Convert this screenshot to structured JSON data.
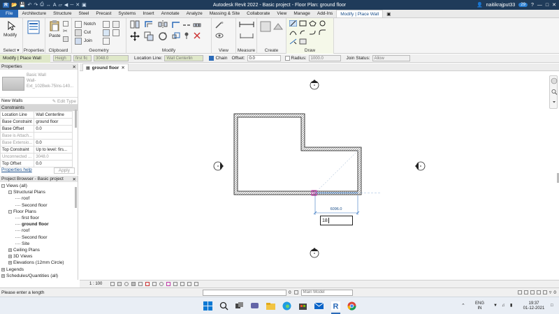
{
  "titlebar": {
    "title": "Autodesk Revit 2022 - Basic project - Floor Plan: ground floor",
    "user": "naitikrajput33",
    "timer": "29"
  },
  "tabs": [
    "File",
    "Architecture",
    "Structure",
    "Steel",
    "Precast",
    "Systems",
    "Insert",
    "Annotate",
    "Analyze",
    "Massing & Site",
    "Collaborate",
    "View",
    "Manage",
    "Add-Ins",
    "Modify | Place Wall"
  ],
  "active_tab": "Modify | Place Wall",
  "ribbon": {
    "select_label": "Select",
    "modify_label": "Modify",
    "properties_label": "Properties",
    "clipboard_label": "Clipboard",
    "paste_label": "Paste",
    "geometry_label": "Geometry",
    "notch_label": "Notch",
    "cut_label": "Cut",
    "join_label": "Join",
    "modify_panel_label": "Modify",
    "view_label": "View",
    "measure_label": "Measure",
    "create_label": "Create",
    "draw_label": "Draw"
  },
  "options_bar": {
    "context": "Modify | Place Wall",
    "height_label": "Heigh",
    "height_value": "first flc",
    "height_number": "3048.0",
    "location_line_label": "Location Line:",
    "location_line_value": "Wall Centerlin",
    "chain_label": "Chain",
    "offset_label": "Offset:",
    "offset_value": "0.0",
    "radius_label": "Radius:",
    "radius_value": "1000.0",
    "join_status_label": "Join Status:",
    "join_status_value": "Allow"
  },
  "properties": {
    "title": "Properties",
    "type_name_line1": "Basic Wall",
    "type_name_line2": "Wall-",
    "type_name_line3": "Ext_102Bwk-75Ins-140...",
    "new_walls": "New Walls",
    "edit_type": "Edit Type",
    "section": "Constraints",
    "rows": [
      {
        "k": "Location Line",
        "v": "Wall Centerline"
      },
      {
        "k": "Base Constraint",
        "v": "ground floor"
      },
      {
        "k": "Base Offset",
        "v": "0.0"
      },
      {
        "k": "Base is Attach...",
        "v": ""
      },
      {
        "k": "Base Extensio...",
        "v": "0.0"
      },
      {
        "k": "Top Constraint",
        "v": "Up to level: firs..."
      },
      {
        "k": "Unconnected ...",
        "v": "3048.0"
      },
      {
        "k": "Top Offset",
        "v": "0.0"
      }
    ],
    "help_link": "Properties help",
    "apply_label": "Apply"
  },
  "project_browser": {
    "title": "Project Browser - Basic project",
    "items": [
      {
        "label": "Views (all)",
        "level": 0,
        "toggle": "-"
      },
      {
        "label": "Structural Plans",
        "level": 1,
        "toggle": "-"
      },
      {
        "label": "roof",
        "level": 2,
        "toggle": ""
      },
      {
        "label": "Second floor",
        "level": 2,
        "toggle": ""
      },
      {
        "label": "Floor Plans",
        "level": 1,
        "toggle": "-"
      },
      {
        "label": "first floor",
        "level": 2,
        "toggle": ""
      },
      {
        "label": "ground floor",
        "level": 2,
        "toggle": "",
        "bold": true
      },
      {
        "label": "roof",
        "level": 2,
        "toggle": ""
      },
      {
        "label": "Second floor",
        "level": 2,
        "toggle": ""
      },
      {
        "label": "Site",
        "level": 2,
        "toggle": ""
      },
      {
        "label": "Ceiling Plans",
        "level": 1,
        "toggle": "+"
      },
      {
        "label": "3D Views",
        "level": 1,
        "toggle": "+"
      },
      {
        "label": "Elevations (12mm Circle)",
        "level": 1,
        "toggle": "+"
      },
      {
        "label": "Legends",
        "level": 0,
        "toggle": "+"
      },
      {
        "label": "Schedules/Quantities (all)",
        "level": 0,
        "toggle": "+"
      }
    ]
  },
  "view_tab": {
    "label": "ground floor"
  },
  "canvas": {
    "dimension_value": "6096.0",
    "length_input": "18"
  },
  "view_bar": {
    "scale": "1 : 100"
  },
  "status_bar": {
    "message": "Please enter a length",
    "workset_value": "0",
    "model_value": "Main Model",
    "filter_value": "0"
  },
  "taskbar": {
    "lang_line1": "ENG",
    "lang_line2": "IN",
    "time": "19:37",
    "date": "01-12-2021"
  },
  "colors": {
    "title_bg": "#1f3b5a",
    "accent": "#2a6ab8",
    "context_green": "#dfe8c9",
    "dim_blue": "#3a78c2",
    "snap_magenta": "#c03aa8"
  }
}
